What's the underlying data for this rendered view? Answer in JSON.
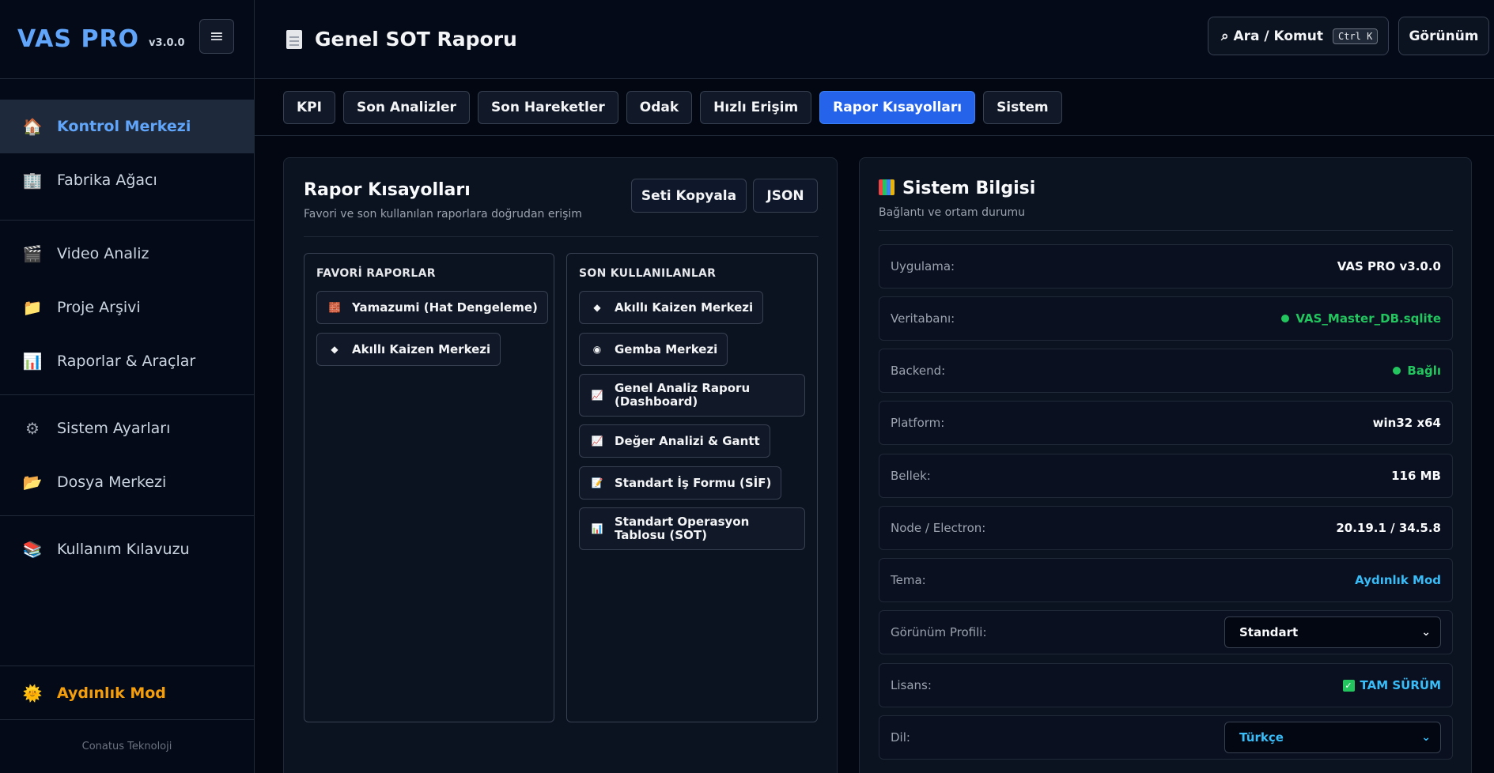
{
  "brand": {
    "name": "VAS PRO",
    "version": "v3.0.0",
    "menu_icon": "≡"
  },
  "sidebar": {
    "groups": [
      [
        {
          "label": "Kontrol Merkezi",
          "icon": "home-icon",
          "glyph": "🏠",
          "active": true
        },
        {
          "label": "Fabrika Ağacı",
          "icon": "building-icon",
          "glyph": "🏢"
        }
      ],
      [
        {
          "label": "Video Analiz",
          "icon": "clapper-icon",
          "glyph": "🎬"
        },
        {
          "label": "Proje Arşivi",
          "icon": "folder-icon",
          "glyph": "📁"
        },
        {
          "label": "Raporlar & Araçlar",
          "icon": "chart-icon",
          "glyph": "📊"
        }
      ],
      [
        {
          "label": "Sistem Ayarları",
          "icon": "gear-icon",
          "glyph": "⚙"
        },
        {
          "label": "Dosya Merkezi",
          "icon": "open-folder-icon",
          "glyph": "📂"
        }
      ],
      [
        {
          "label": "Kullanım Kılavuzu",
          "icon": "books-icon",
          "glyph": "📚"
        }
      ]
    ],
    "mode_label": "Aydınlık Mod",
    "mode_glyph": "🌞",
    "footer": "Conatus Teknoloji"
  },
  "header": {
    "title": "Genel SOT Raporu",
    "search_label": "⌕ Ara / Komut",
    "search_kbd": "Ctrl K",
    "view_label": "Görünüm"
  },
  "tabs": [
    "KPI",
    "Son Analizler",
    "Son Hareketler",
    "Odak",
    "Hızlı Erişim",
    "Rapor Kısayolları",
    "Sistem"
  ],
  "active_tab": "Rapor Kısayolları",
  "report_panel": {
    "title": "Rapor Kısayolları",
    "subtitle": "Favori ve son kullanılan raporlara doğrudan erişim",
    "copy_button": "Seti Kopyala",
    "json_button": "JSON",
    "favorites_title": "FAVORİ RAPORLAR",
    "favorites": [
      {
        "label": "Yamazumi (Hat Dengeleme)",
        "icon": "bricks-icon",
        "glyph": "🧱"
      },
      {
        "label": "Akıllı Kaizen Merkezi",
        "icon": "diamond-icon",
        "glyph": "◆"
      }
    ],
    "recent_title": "SON KULLANILANLAR",
    "recent": [
      {
        "label": "Akıllı Kaizen Merkezi",
        "icon": "diamond-icon",
        "glyph": "◆"
      },
      {
        "label": "Gemba Merkezi",
        "icon": "gemba-icon",
        "glyph": "◉"
      },
      {
        "label": "Genel Analiz Raporu (Dashboard)",
        "icon": "trend-chart-icon",
        "glyph": "📈"
      },
      {
        "label": "Değer Analizi & Gantt",
        "icon": "trend-chart-icon",
        "glyph": "📈"
      },
      {
        "label": "Standart İş Formu (SİF)",
        "icon": "memo-icon",
        "glyph": "📝"
      },
      {
        "label": "Standart Operasyon Tablosu (SOT)",
        "icon": "bar-chart-icon",
        "glyph": "📊"
      }
    ]
  },
  "system_panel": {
    "title": "Sistem Bilgisi",
    "subtitle": "Bağlantı ve ortam durumu",
    "rows": [
      {
        "label": "Uygulama:",
        "value": "VAS PRO v3.0.0"
      },
      {
        "label": "Veritabanı:",
        "value": "VAS_Master_DB.sqlite",
        "status_color": "#22c55e"
      },
      {
        "label": "Backend:",
        "value": "Bağlı",
        "status_color": "#22c55e"
      },
      {
        "label": "Platform:",
        "value": "win32 x64"
      },
      {
        "label": "Bellek:",
        "value": "116 MB"
      },
      {
        "label": "Node / Electron:",
        "value": "20.19.1 / 34.5.8"
      },
      {
        "label": "Tema:",
        "value": "Aydınlık Mod"
      },
      {
        "label": "Görünüm Profili:",
        "value": "Standart"
      },
      {
        "label": "Lisans:",
        "value": "TAM SÜRÜM"
      },
      {
        "label": "Dil:",
        "value": "Türkçe"
      }
    ]
  },
  "colors": {
    "accent": "#2563eb",
    "brand": "#60a5fa",
    "success": "#22c55e",
    "info": "#38bdf8",
    "mode": "#f59e0b"
  }
}
